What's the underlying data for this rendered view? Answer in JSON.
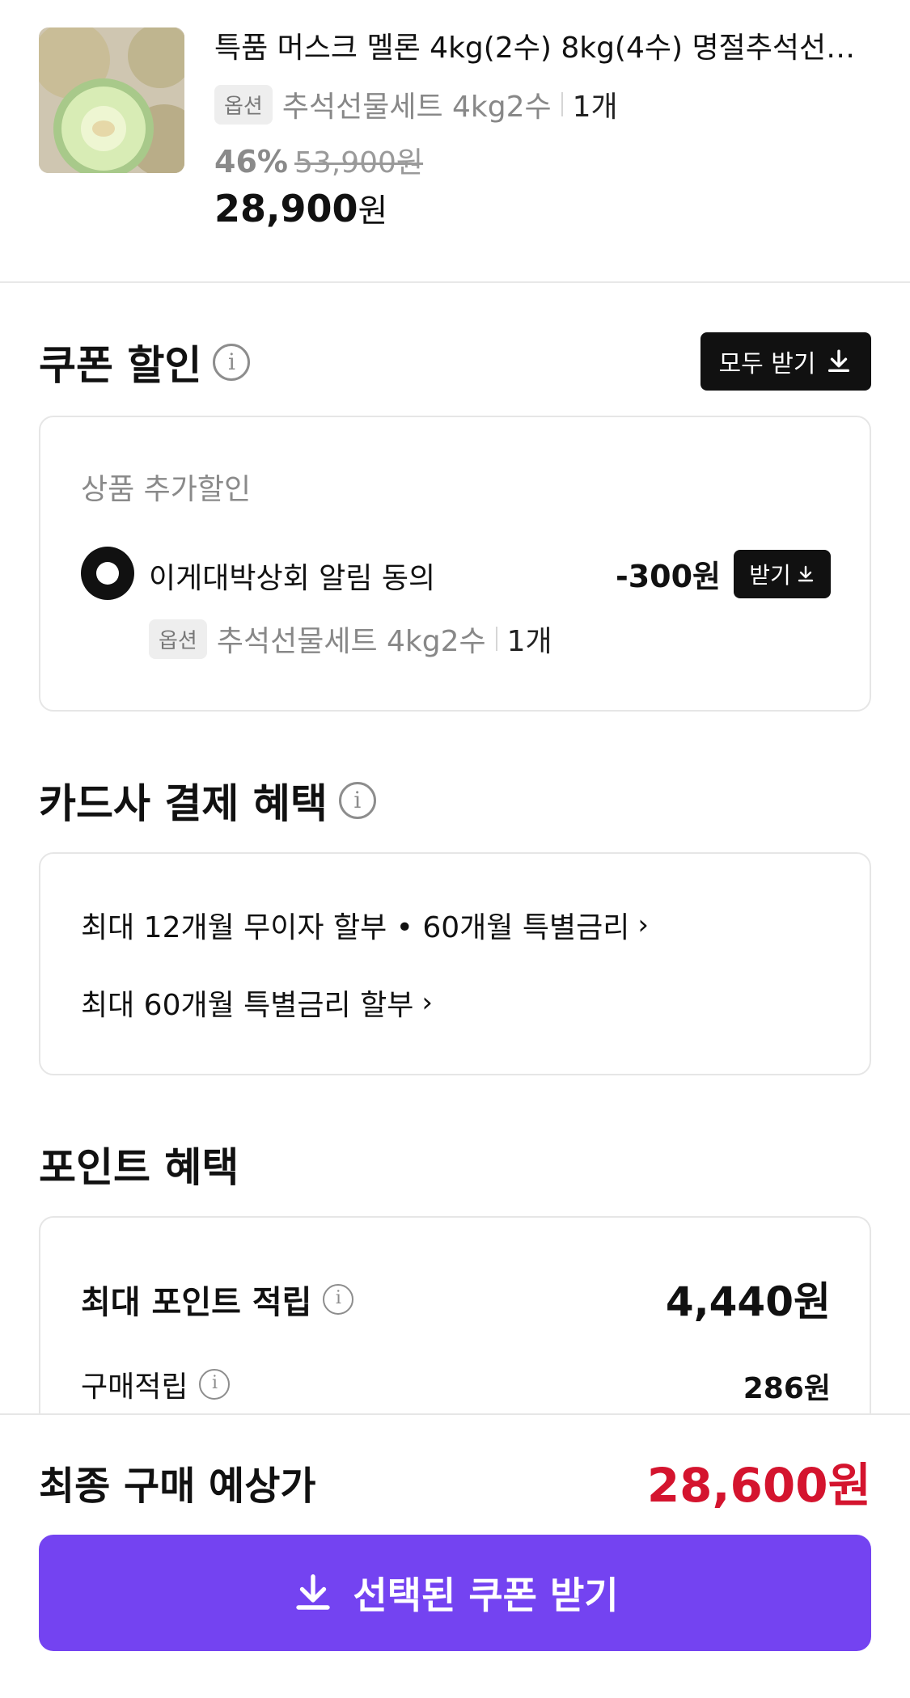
{
  "product": {
    "title": "특품 머스크 멜론 4kg(2수) 8kg(4수) 명절추석선물세트",
    "option_badge": "옵션",
    "option_text": "추석선물세트 4kg2수",
    "quantity": "1개",
    "discount_pct": "46%",
    "original_price": "53,900원",
    "price_num": "28,900",
    "price_unit": "원",
    "image_icon": "melon-image"
  },
  "coupon": {
    "title": "쿠폰 할인",
    "get_all_label": "모두 받기",
    "section_sub": "상품 추가할인",
    "item_name": "이게대박상회 알림 동의",
    "item_amount": "-300원",
    "get_label": "받기",
    "option_badge": "옵션",
    "option_text": "추석선물세트 4kg2수",
    "quantity": "1개"
  },
  "card_benefit": {
    "title": "카드사 결제 혜택",
    "line1": "최대 12개월 무이자 할부 • 60개월 특별금리",
    "line2": "최대 60개월 특별금리 할부"
  },
  "points": {
    "title": "포인트 혜택",
    "max_label": "최대 포인트 적립",
    "max_value": "4,440원",
    "purchase_label": "구매적립",
    "purchase_value": "286원"
  },
  "footer": {
    "final_label": "최종 구매 예상가",
    "final_price": "28,600원",
    "cta_label": "선택된 쿠폰 받기"
  },
  "colors": {
    "accent": "#7443f1",
    "price_red": "#d4142e",
    "dark": "#111111"
  }
}
